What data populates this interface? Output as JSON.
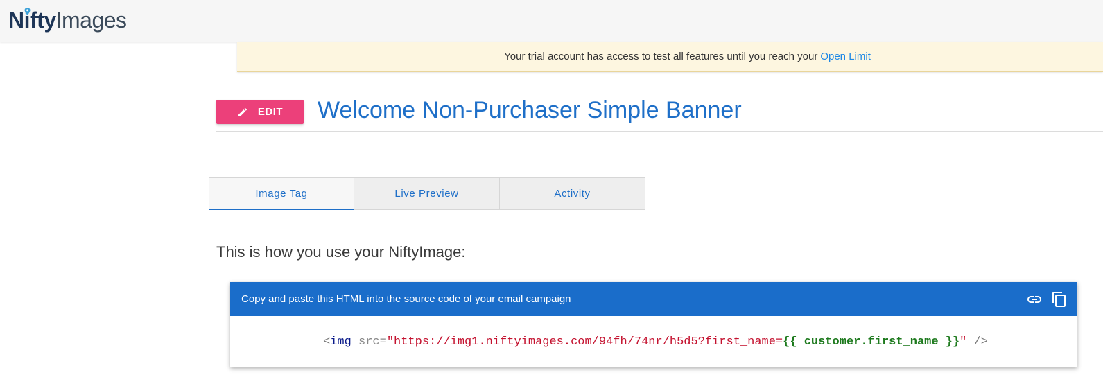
{
  "header": {
    "logo_bold": "Nifty",
    "logo_light": "Images"
  },
  "trial_banner": {
    "message": "Your trial account has access to test all features until you reach your",
    "link_label": "Open Limit"
  },
  "main": {
    "edit_label": "EDIT",
    "title": "Welcome Non-Purchaser Simple Banner",
    "tabs": [
      {
        "label": "Image Tag",
        "active": true
      },
      {
        "label": "Live Preview",
        "active": false
      },
      {
        "label": "Activity",
        "active": false
      }
    ],
    "usage_text": "This is how you use your NiftyImage:"
  },
  "code_card": {
    "header_text": "Copy and paste this HTML into the source code of your email campaign",
    "link_icon": "link-icon",
    "copy_icon": "copy-icon",
    "code": {
      "open": "<",
      "tag": "img",
      "attr": " src=",
      "url": "\"https://img1.niftyimages.com/94fh/74nr/h5d5?first_name=",
      "variable": "{{ customer.first_name }}",
      "close_quote": "\"",
      "end": " />"
    }
  },
  "colors": {
    "brand_blue": "#1a6dca",
    "edit_pink": "#ec407a",
    "trial_bg": "#fdf6e0",
    "link_blue": "#1e88e5"
  }
}
